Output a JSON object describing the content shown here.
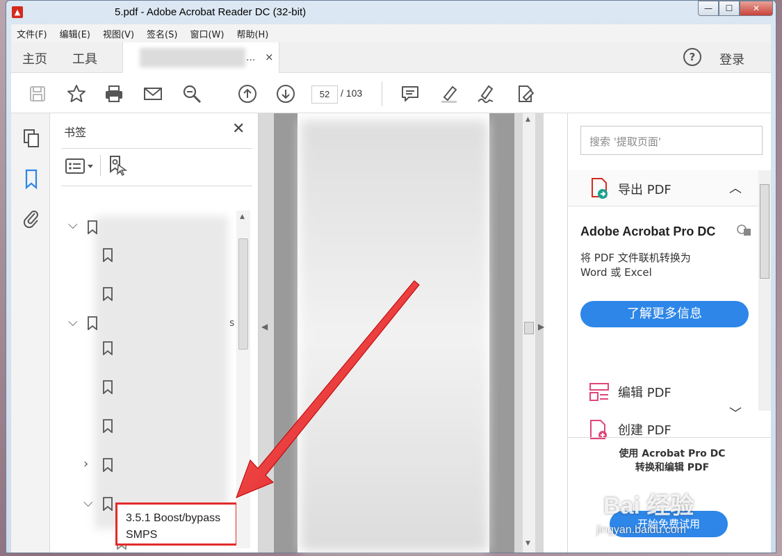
{
  "window": {
    "title": "5.pdf - Adobe Acrobat Reader DC (32-bit)",
    "app_icon": "pdf-icon",
    "controls": [
      "minimize",
      "maximize",
      "close"
    ]
  },
  "menubar": [
    "文件(F)",
    "编辑(E)",
    "视图(V)",
    "签名(S)",
    "窗口(W)",
    "帮助(H)"
  ],
  "tabs": {
    "home": "主页",
    "tools": "工具",
    "document_ellipsis": "...",
    "close": "×",
    "help": "?",
    "signin": "登录"
  },
  "toolbar": {
    "page_current": "52",
    "page_total": "/ 103",
    "icons": [
      "save-icon",
      "star-icon",
      "print-icon",
      "mail-icon",
      "zoom-icon",
      "page-up-icon",
      "page-down-icon",
      "comment-icon",
      "highlight-icon",
      "sign-icon",
      "fill-sign-icon"
    ]
  },
  "bookmarks": {
    "title": "书签",
    "close": "✕",
    "partial_text": "s",
    "highlighted_item_line1": "3.5.1 Boost/bypass",
    "highlighted_item_line2": "SMPS"
  },
  "right_panel": {
    "search_placeholder": "搜索 '提取页面'",
    "export_label": "导出 PDF",
    "pro_title": "Adobe Acrobat Pro DC",
    "pro_desc_line1": "将 PDF 文件联机转换为",
    "pro_desc_line2": "Word 或 Excel",
    "learn_more": "了解更多信息",
    "edit_pdf": "编辑 PDF",
    "create_pdf": "创建 PDF",
    "promo_line1": "使用 Acrobat Pro DC",
    "promo_line2": "转换和编辑 PDF",
    "promo_button": "开始免费试用"
  },
  "watermark": {
    "logo": "Bai 经验",
    "url": "jingyan.baidu.com"
  },
  "colors": {
    "accent": "#2d86e8",
    "annotation_red": "#e42a2a",
    "pdf_red": "#d42a1e",
    "tool_pink": "#e0457b"
  }
}
